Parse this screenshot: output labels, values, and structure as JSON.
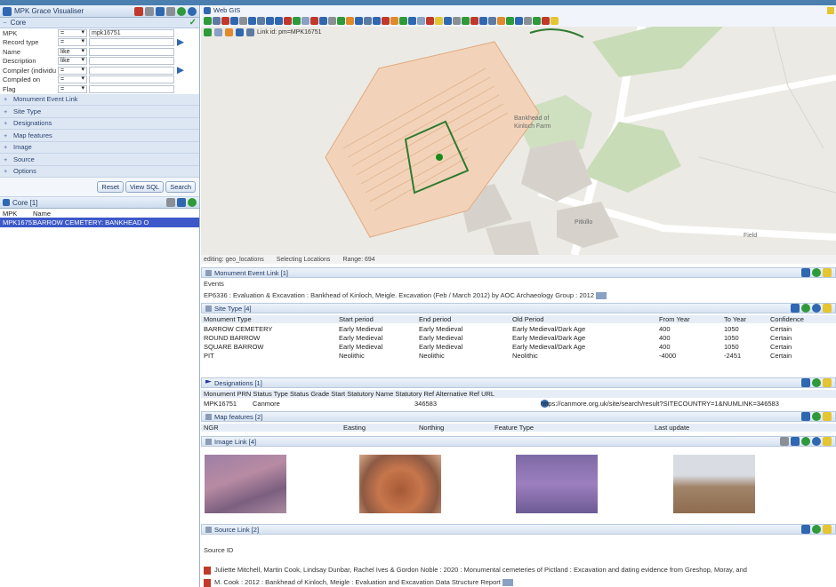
{
  "left": {
    "title": "MPK Grace Visualiser",
    "core_title": "Core",
    "form": [
      {
        "label": "MPK",
        "op": "=",
        "value": "mpk16751"
      },
      {
        "label": "Record type",
        "op": "=",
        "value": ""
      },
      {
        "label": "Name",
        "op": "like",
        "value": ""
      },
      {
        "label": "Description",
        "op": "like",
        "value": ""
      },
      {
        "label": "Compiler (individu",
        "op": "=",
        "value": ""
      },
      {
        "label": "Compiled on",
        "op": "=",
        "value": ""
      },
      {
        "label": "Flag",
        "op": "=",
        "value": ""
      }
    ],
    "sections": [
      "Monument Event Link",
      "Site Type",
      "Designations",
      "Map features",
      "Image",
      "Source",
      "Options"
    ],
    "buttons": {
      "reset": "Reset",
      "view_sql": "View SQL",
      "search": "Search"
    },
    "results": {
      "title": "Core [1]",
      "col_mpk": "MPK",
      "col_name": "Name",
      "row_mpk": "MPK16751",
      "row_name": "BARROW CEMETERY: BANKHEAD O"
    }
  },
  "map": {
    "title": "Web GIS",
    "link_label": "Link id:  pm=MPK16751",
    "labels": [
      "Bankhead of Kinloch Farm",
      "Pitkillo",
      "Field"
    ],
    "status": [
      "editing: geo_locations",
      "Selecting Locations",
      "Range: 694"
    ]
  },
  "records": {
    "mel": {
      "title": "Monument Event Link [1]",
      "sub": "Events",
      "row": "EP6336 : Evaluation & Excavation : Bankhead of Kinloch, Meigle. Excavation (Feb / March 2012) by AOC Archaeology Group : 2012"
    },
    "site_type": {
      "title": "Site Type [4]",
      "headers": [
        "Monument Type",
        "Start period",
        "End period",
        "Old Period",
        "From Year",
        "To Year",
        "Confidence"
      ],
      "rows": [
        [
          "BARROW CEMETERY",
          "Early Medieval",
          "Early Medieval",
          "Early Medieval/Dark Age",
          "400",
          "1050",
          "Certain"
        ],
        [
          "ROUND BARROW",
          "Early Medieval",
          "Early Medieval",
          "Early Medieval/Dark Age",
          "400",
          "1050",
          "Certain"
        ],
        [
          "SQUARE BARROW",
          "Early Medieval",
          "Early Medieval",
          "Early Medieval/Dark Age",
          "400",
          "1050",
          "Certain"
        ],
        [
          "PIT",
          "Neolithic",
          "Neolithic",
          "Neolithic",
          "-4000",
          "-2451",
          "Certain"
        ]
      ]
    },
    "designations": {
      "title": "Designations [1]",
      "headers": "Monument PRN  Status Type  Status Grade  Start  Statutory Name  Statutory Ref  Alternative Ref  URL",
      "row_prn": "MPK16751",
      "row_status": "Canmore",
      "row_ref": "346583",
      "row_url": "https://canmore.org.uk/site/search/result?SITECOUNTRY=1&NUMLINK=346583"
    },
    "map_features": {
      "title": "Map features [2]",
      "headers": [
        "NGR",
        "Easting",
        "Northing",
        "Feature Type",
        "Last update"
      ]
    },
    "images": {
      "title": "Image Link [4]"
    },
    "source": {
      "title": "Source Link [2]",
      "sub": "Source ID",
      "rows": [
        "Juliette Mitchell, Martin Cook, Lindsay Dunbar, Rachel Ives & Gordon Noble : 2020 : Monumental cemeteries of Pictland : Excavation and dating evidence from Greshop, Moray, and",
        "M. Cook : 2012 : Bankhead of Kinloch, Meigle : Evaluation and Excavation Data Structure Report"
      ]
    }
  }
}
